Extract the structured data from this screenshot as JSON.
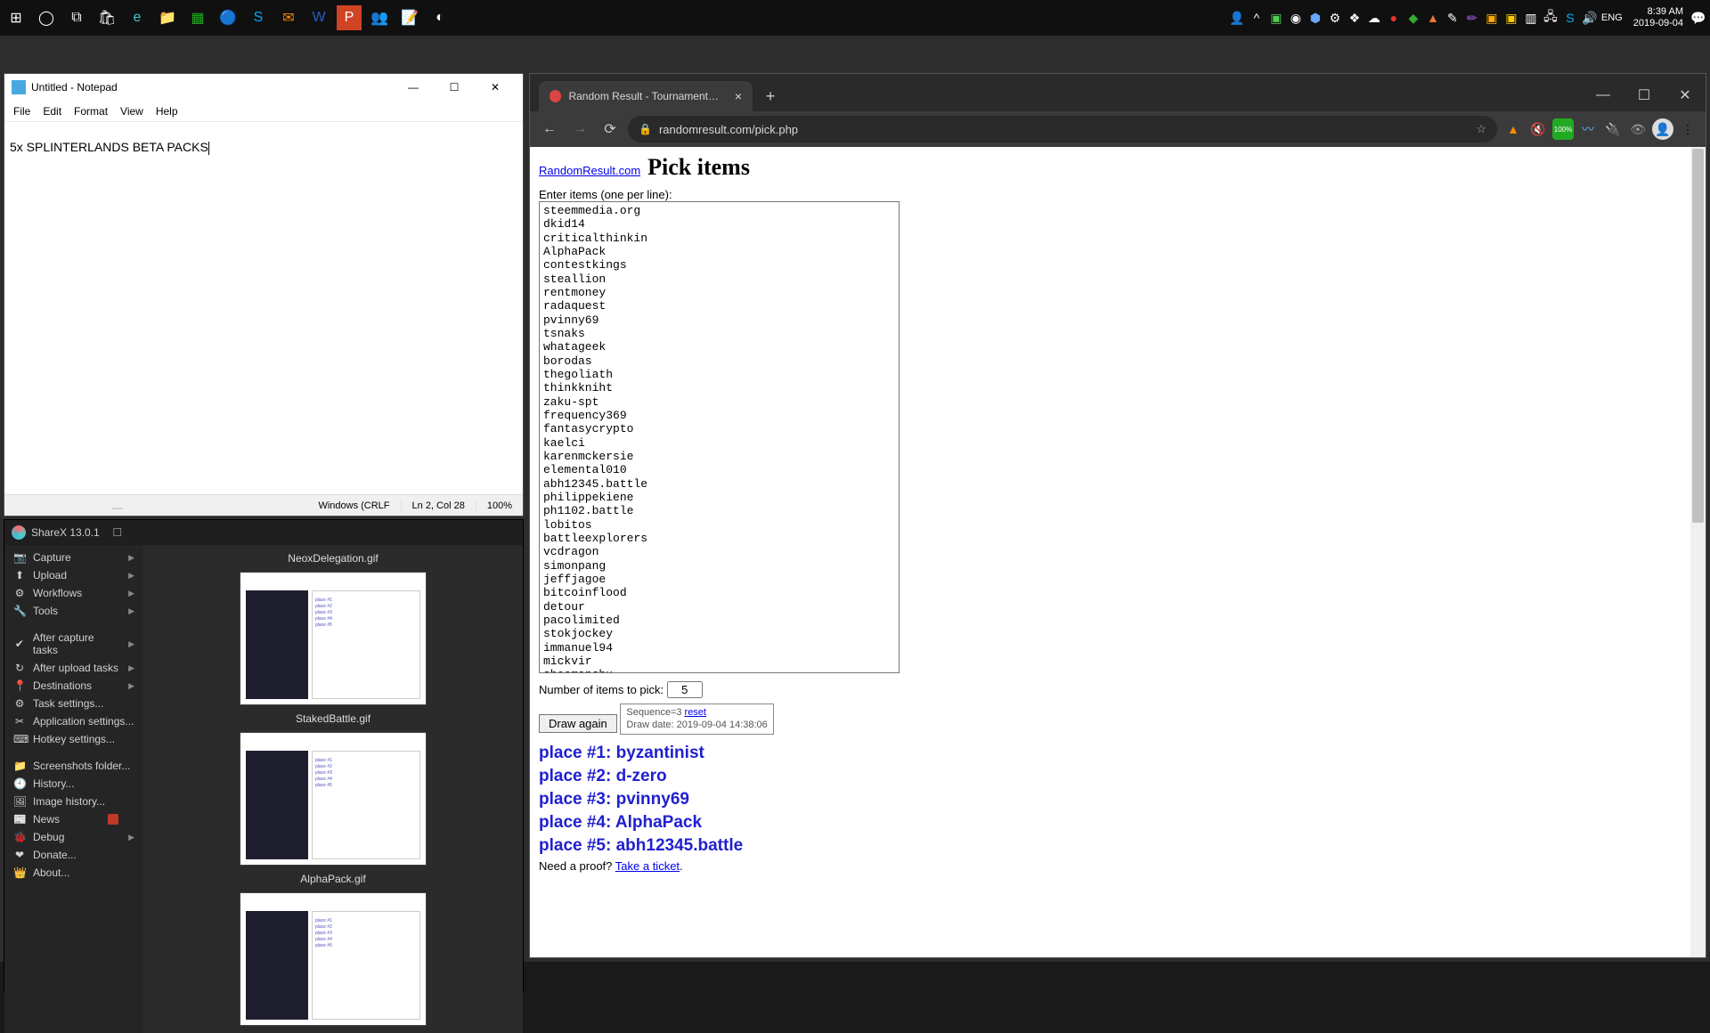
{
  "taskbar": {
    "clock_time": "8:39 AM",
    "clock_date": "2019-09-04",
    "lang": "ENG"
  },
  "notepad": {
    "title": "Untitled - Notepad",
    "menu": [
      "File",
      "Edit",
      "Format",
      "View",
      "Help"
    ],
    "content": "5x SPLINTERLANDS BETA PACKS",
    "status_enc": "Windows (CRLF",
    "status_pos": "Ln 2, Col 28",
    "status_zoom": "100%"
  },
  "sharex": {
    "title": "ShareX 13.0.1",
    "side": [
      {
        "ico": "📷",
        "label": "Capture",
        "chev": true
      },
      {
        "ico": "⬆",
        "label": "Upload",
        "chev": true
      },
      {
        "ico": "⚙",
        "label": "Workflows",
        "chev": true
      },
      {
        "ico": "🔧",
        "label": "Tools",
        "chev": true
      },
      {
        "sep": true
      },
      {
        "ico": "✔",
        "label": "After capture tasks",
        "chev": true
      },
      {
        "ico": "↻",
        "label": "After upload tasks",
        "chev": true
      },
      {
        "ico": "📍",
        "label": "Destinations",
        "chev": true
      },
      {
        "ico": "⚙",
        "label": "Task settings..."
      },
      {
        "ico": "✂",
        "label": "Application settings..."
      },
      {
        "ico": "⌨",
        "label": "Hotkey settings..."
      },
      {
        "sep": true
      },
      {
        "ico": "📁",
        "label": "Screenshots folder..."
      },
      {
        "ico": "🕘",
        "label": "History..."
      },
      {
        "ico": "🖼",
        "label": "Image history..."
      },
      {
        "ico": "📰",
        "label": "News",
        "badge": true
      },
      {
        "ico": "🐞",
        "label": "Debug",
        "chev": true
      },
      {
        "ico": "❤",
        "label": "Donate..."
      },
      {
        "ico": "👑",
        "label": "About..."
      }
    ],
    "thumbs": [
      "NeoxDelegation.gif",
      "StakedBattle.gif",
      "AlphaPack.gif"
    ]
  },
  "chrome": {
    "tab_title": "Random Result - Tournament dra",
    "url": "randomresult.com/pick.php",
    "page": {
      "brand": "RandomResult.com",
      "heading": "Pick items",
      "enter_label": "Enter items (one per line):",
      "items": "steemmedia.org\ndkid14\ncriticalthinkin\nAlphaPack\ncontestkings\nsteallion\nrentmoney\nradaquest\npvinny69\ntsnaks\nwhatageek\nborodas\nthegoliath\nthinkkniht\nzaku-spt\nfrequency369\nfantasycrypto\nkaelci\nkarenmckersie\nelemental010\nabh12345.battle\nphilippekiene\nph1102.battle\nlobitos\nbattleexplorers\nvcdragon\nsimonpang\njeffjagoe\nbitcoinflood\ndetour\npacolimited\nstokjockey\nimmanuel94\nmickvir\nshoemanchu",
      "num_label": "Number of items to pick:",
      "num_value": "5",
      "draw_btn": "Draw again",
      "seq_text": "Sequence=3 ",
      "seq_reset": "reset",
      "seq_date": "Draw date: 2019-09-04 14:38:06",
      "results": [
        "place #1: byzantinist",
        "place #2: d-zero",
        "place #3: pvinny69",
        "place #4: AlphaPack",
        "place #5: abh12345.battle"
      ],
      "proof_text": "Need a proof? ",
      "proof_link": "Take a ticket"
    }
  }
}
